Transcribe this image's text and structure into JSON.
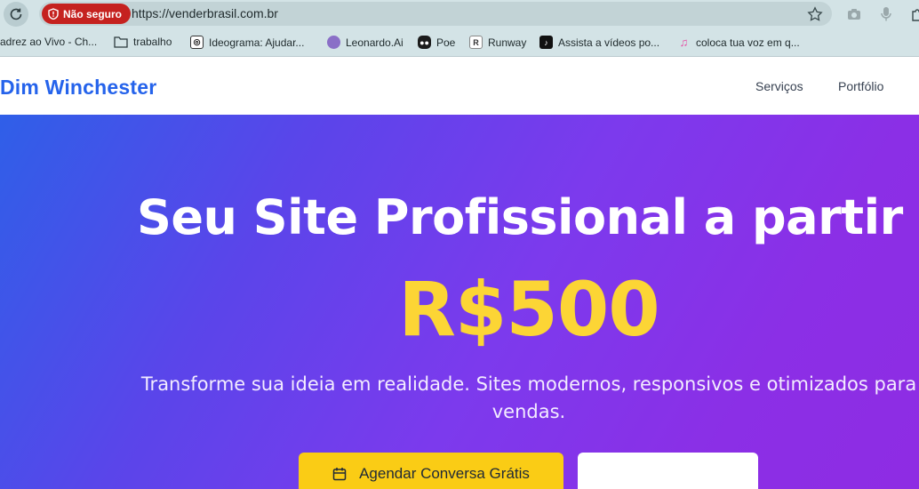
{
  "browser": {
    "security_label": "Não seguro",
    "url": "https://venderbrasil.com.br",
    "bookmarks": [
      {
        "label": "Xadrez ao Vivo - Ch...",
        "icon": "chess-icon"
      },
      {
        "label": "trabalho",
        "icon": "folder-icon"
      },
      {
        "label": "Ideograma: Ajudar...",
        "icon": "ideogram-icon"
      },
      {
        "label": "Leonardo.Ai",
        "icon": "leonardo-icon"
      },
      {
        "label": "Poe",
        "icon": "poe-icon"
      },
      {
        "label": "Runway",
        "icon": "runway-icon"
      },
      {
        "label": "Assista a vídeos po...",
        "icon": "tiktok-icon"
      },
      {
        "label": "coloca tua voz em q...",
        "icon": "music-icon"
      }
    ]
  },
  "site": {
    "brand": "Dim Winchester",
    "nav": [
      {
        "label": "Serviços"
      },
      {
        "label": "Portfólio"
      }
    ]
  },
  "hero": {
    "title": "Seu Site Profissional a partir de",
    "price": "R$500",
    "subtitle": "Transforme sua ideia em realidade. Sites modernos, responsivos e otimizados para vendas.",
    "primary_button": "Agendar Conversa Grátis",
    "secondary_button": ""
  },
  "colors": {
    "brand": "#2563eb",
    "price": "#fcd535",
    "primary_button": "#facc15",
    "security_chip": "#c5221f"
  }
}
